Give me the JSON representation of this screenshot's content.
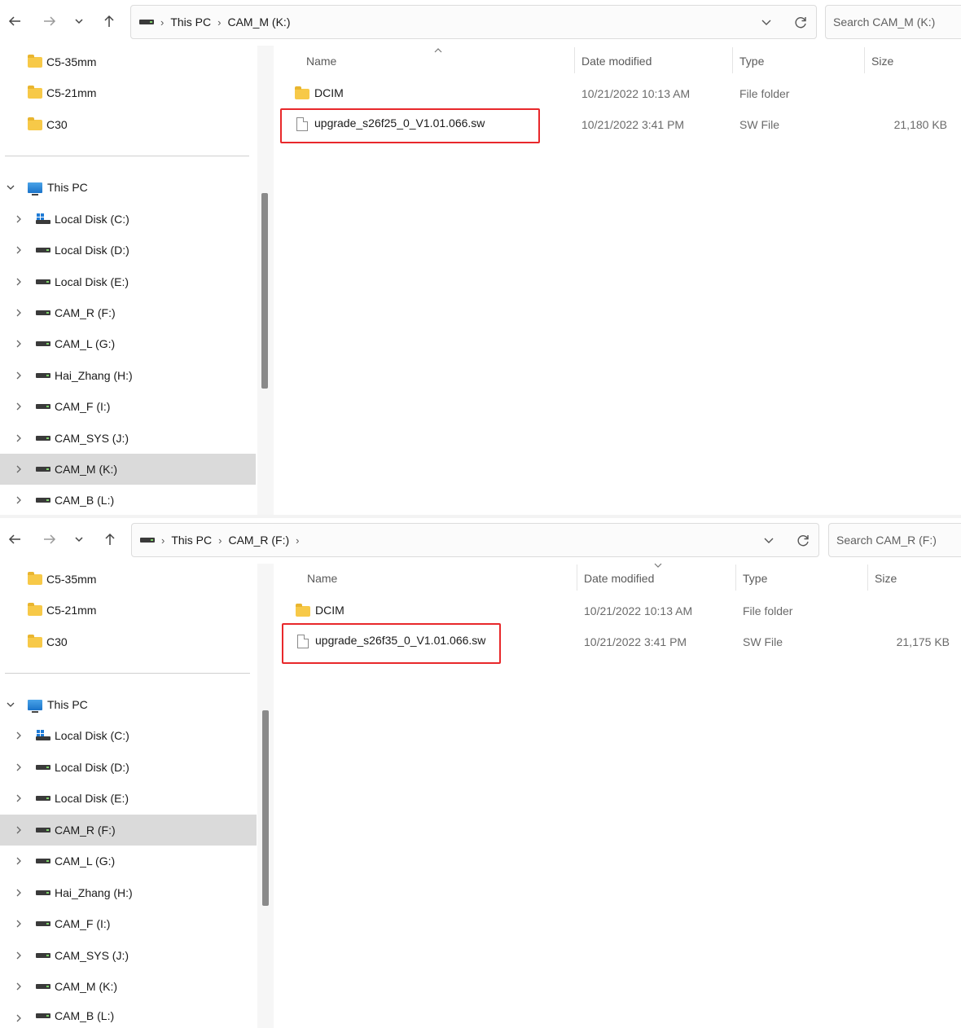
{
  "windows": [
    {
      "address": {
        "crumbs": [
          "This PC",
          "CAM_M (K:)"
        ],
        "trailing_chevron": false
      },
      "search": {
        "placeholder": "Search CAM_M (K:)"
      },
      "quick_access": [
        "C5-35mm",
        "C5-21mm",
        "C30"
      ],
      "this_pc_label": "This PC",
      "drives": [
        {
          "label": "Local Disk (C:)",
          "system": true
        },
        {
          "label": "Local Disk (D:)"
        },
        {
          "label": "Local Disk (E:)"
        },
        {
          "label": "CAM_R (F:)"
        },
        {
          "label": "CAM_L (G:)"
        },
        {
          "label": "Hai_Zhang (H:)"
        },
        {
          "label": "CAM_F (I:)"
        },
        {
          "label": "CAM_SYS (J:)"
        },
        {
          "label": "CAM_M (K:)",
          "selected": true
        },
        {
          "label": "CAM_B (L:)"
        }
      ],
      "columns": {
        "name": "Name",
        "date": "Date modified",
        "type": "Type",
        "size": "Size"
      },
      "files": [
        {
          "name": "DCIM",
          "kind": "folder",
          "date": "10/21/2022 10:13 AM",
          "type": "File folder",
          "size": ""
        },
        {
          "name": "upgrade_s26f25_0_V1.01.066.sw",
          "kind": "file",
          "date": "10/21/2022 3:41 PM",
          "type": "SW File",
          "size": "21,180 KB",
          "highlighted": true
        }
      ]
    },
    {
      "address": {
        "crumbs": [
          "This PC",
          "CAM_R (F:)"
        ],
        "trailing_chevron": true
      },
      "search": {
        "placeholder": "Search CAM_R (F:)"
      },
      "quick_access": [
        "C5-35mm",
        "C5-21mm",
        "C30"
      ],
      "this_pc_label": "This PC",
      "drives": [
        {
          "label": "Local Disk (C:)",
          "system": true
        },
        {
          "label": "Local Disk (D:)"
        },
        {
          "label": "Local Disk (E:)"
        },
        {
          "label": "CAM_R (F:)",
          "selected": true
        },
        {
          "label": "CAM_L (G:)"
        },
        {
          "label": "Hai_Zhang (H:)"
        },
        {
          "label": "CAM_F (I:)"
        },
        {
          "label": "CAM_SYS (J:)"
        },
        {
          "label": "CAM_M (K:)"
        },
        {
          "label": "CAM_B (L:)"
        }
      ],
      "columns": {
        "name": "Name",
        "date": "Date modified",
        "type": "Type",
        "size": "Size"
      },
      "files": [
        {
          "name": "DCIM",
          "kind": "folder",
          "date": "10/21/2022 10:13 AM",
          "type": "File folder",
          "size": ""
        },
        {
          "name": "upgrade_s26f35_0_V1.01.066.sw",
          "kind": "file",
          "date": "10/21/2022 3:41 PM",
          "type": "SW File",
          "size": "21,175 KB",
          "highlighted": true
        }
      ]
    }
  ],
  "colors": {
    "highlight": "#e8282b",
    "selected_row": "#dadada",
    "folder": "#f7c948"
  }
}
